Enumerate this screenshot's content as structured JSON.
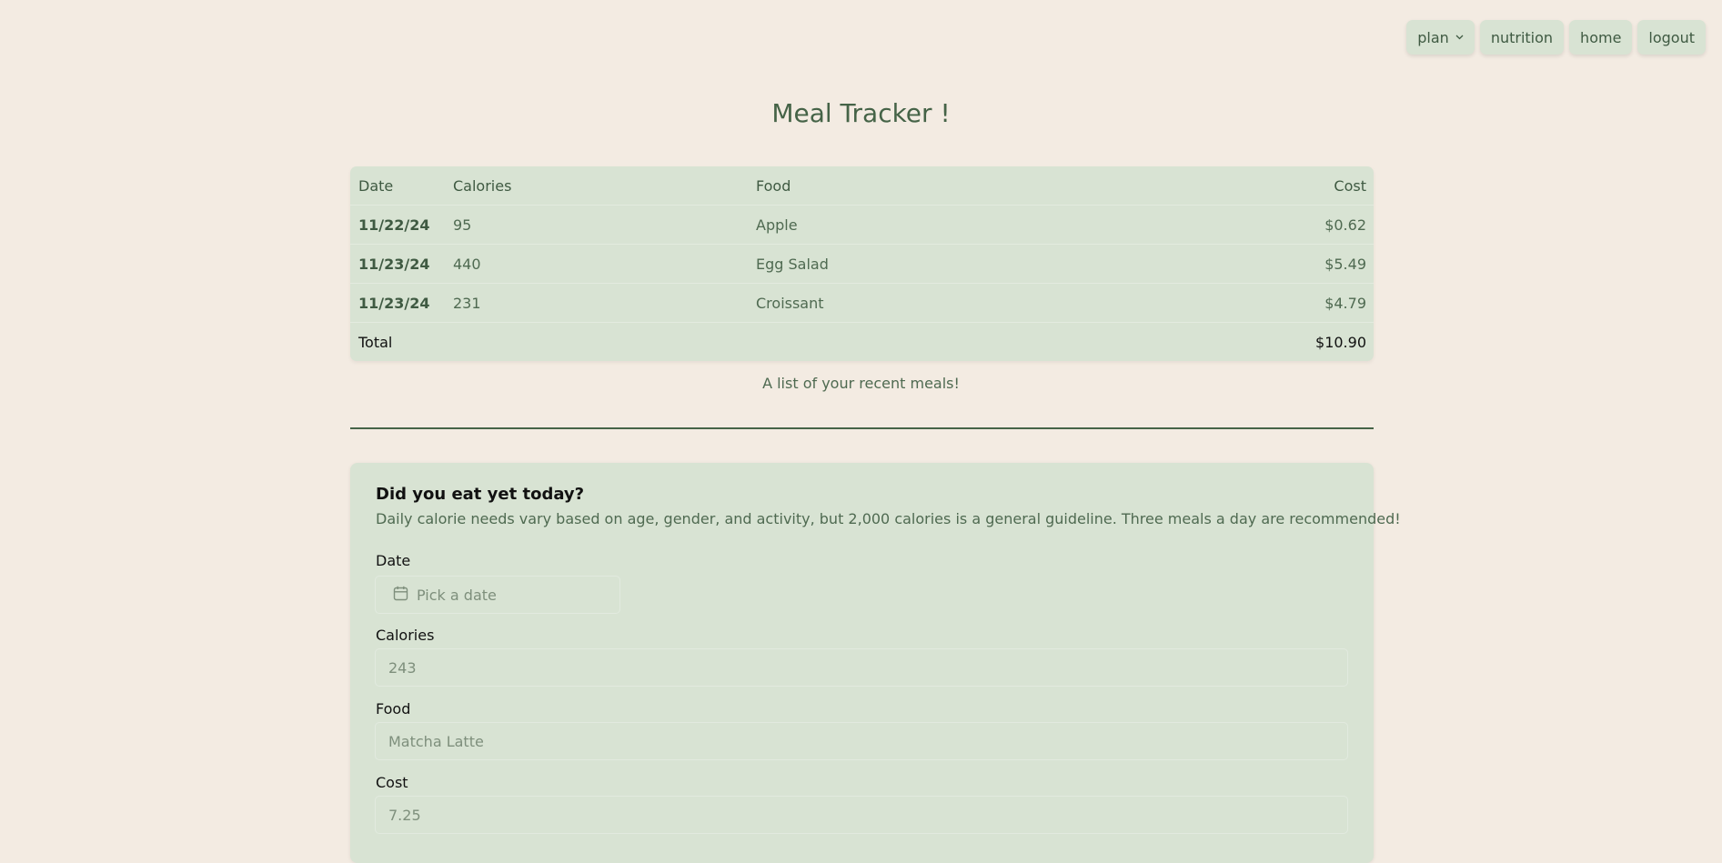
{
  "nav": {
    "plan_label": "plan",
    "nutrition_label": "nutrition",
    "home_label": "home",
    "logout_label": "logout"
  },
  "page": {
    "title": "Meal Tracker !",
    "caption": "A list of your recent meals!"
  },
  "table": {
    "headers": {
      "date": "Date",
      "calories": "Calories",
      "food": "Food",
      "cost": "Cost"
    },
    "rows": [
      {
        "date": "11/22/24",
        "calories": "95",
        "food": "Apple",
        "cost": "$0.62"
      },
      {
        "date": "11/23/24",
        "calories": "440",
        "food": "Egg Salad",
        "cost": "$5.49"
      },
      {
        "date": "11/23/24",
        "calories": "231",
        "food": "Croissant",
        "cost": "$4.79"
      }
    ],
    "total_label": "Total",
    "total_value": "$10.90"
  },
  "form": {
    "title": "Did you eat yet today?",
    "description": "Daily calorie needs vary based on age, gender, and activity, but 2,000 calories is a general guideline. Three meals a day are recommended!",
    "date_label": "Date",
    "date_placeholder": "Pick a date",
    "calories_label": "Calories",
    "calories_placeholder": "243",
    "food_label": "Food",
    "food_placeholder": "Matcha Latte",
    "cost_label": "Cost",
    "cost_placeholder": "7.25"
  },
  "icons": {
    "calendar": "calendar-icon",
    "chevron": "chevron-down-icon"
  },
  "colors": {
    "background": "#f3ebe2",
    "panel": "#d8e3d3",
    "accent": "#456347"
  }
}
